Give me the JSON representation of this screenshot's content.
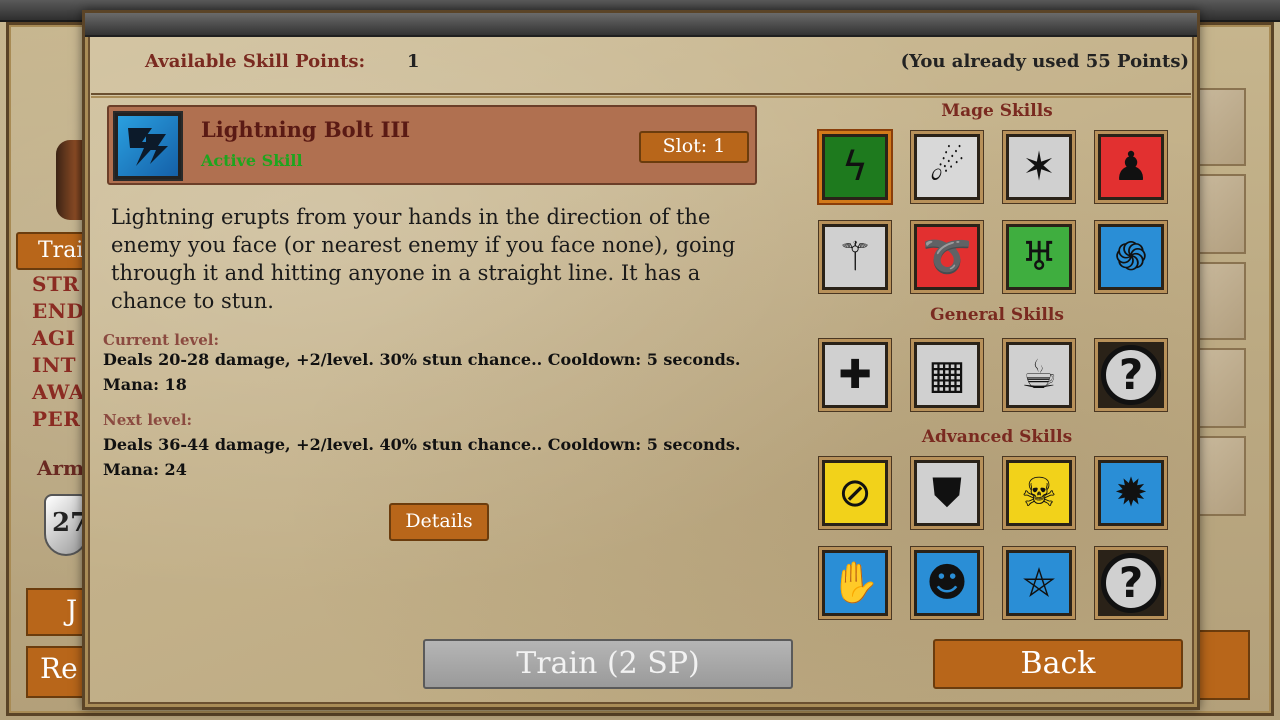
{
  "background": {
    "train_tab": "Trai",
    "stats": [
      "STR",
      "END",
      "AGI",
      "INT",
      "AWA",
      "PER"
    ],
    "armor_label": "Arm",
    "armor_value": "27",
    "btn_top": "J",
    "btn_bottom": "Re"
  },
  "header": {
    "available_label": "Available Skill Points:",
    "available_value": "1",
    "used_text": "(You already used 55 Points)"
  },
  "selected_skill": {
    "name": "Lightning Bolt III",
    "type": "Active Skill",
    "slot_label": "Slot: 1",
    "icon": "lightning-icon",
    "description": "Lightning erupts from your hands in the direction of the enemy you face (or nearest enemy if you face none), going through it and hitting anyone in a straight line. It has a chance to stun.",
    "current_label": "Current level:",
    "current_text": "Deals 20-28 damage, +2/level. 30% stun chance.. Cooldown: 5 seconds. Mana: 18",
    "next_label": "Next level:",
    "next_text": "Deals 36-44 damage, +2/level. 40% stun chance.. Cooldown: 5 seconds. Mana: 24",
    "details_label": "Details"
  },
  "sections": {
    "mage": "Mage Skills",
    "general": "General Skills",
    "advanced": "Advanced Skills"
  },
  "skills": {
    "mage": [
      {
        "icon": "lightning-icon",
        "glyph": "ϟ",
        "bg": "#1e7a1e"
      },
      {
        "icon": "fireball-icon",
        "glyph": "☄",
        "bg": "#d8d8d8"
      },
      {
        "icon": "meteor-icon",
        "glyph": "✶",
        "bg": "#d0d0d0"
      },
      {
        "icon": "protection-figure-icon",
        "glyph": "♟",
        "bg": "#e23030"
      },
      {
        "icon": "staff-icon",
        "glyph": "⚚",
        "bg": "#d0d0d0"
      },
      {
        "icon": "fire-swirl-icon",
        "glyph": "➰",
        "bg": "#e23030"
      },
      {
        "icon": "gargoyle-icon",
        "glyph": "♅",
        "bg": "#3fae3f"
      },
      {
        "icon": "vortex-icon",
        "glyph": "֍",
        "bg": "#2a8ed6"
      }
    ],
    "general": [
      {
        "icon": "heal-cross-icon",
        "glyph": "✚",
        "bg": "#d0d0d0"
      },
      {
        "icon": "maze-icon",
        "glyph": "▦",
        "bg": "#d0d0d0"
      },
      {
        "icon": "beer-mug-icon",
        "glyph": "☕",
        "bg": "#d0d0d0"
      },
      {
        "icon": "unknown-skill-icon",
        "glyph": "?",
        "bg": "#d0d0d0"
      }
    ],
    "advanced": [
      {
        "icon": "no-weapon-icon",
        "glyph": "⊘",
        "bg": "#f2d21a"
      },
      {
        "icon": "armor-plate-icon",
        "glyph": "⛊",
        "bg": "#d0d0d0"
      },
      {
        "icon": "skull-icon",
        "glyph": "☠",
        "bg": "#f2d21a"
      },
      {
        "icon": "shield-burst-icon",
        "glyph": "✹",
        "bg": "#2a8ed6"
      },
      {
        "icon": "hand-swirl-icon",
        "glyph": "✋",
        "bg": "#2a8ed6"
      },
      {
        "icon": "golem-face-icon",
        "glyph": "☻",
        "bg": "#2a8ed6"
      },
      {
        "icon": "pentagram-icon",
        "glyph": "⛤",
        "bg": "#2a8ed6"
      },
      {
        "icon": "unknown-skill-icon",
        "glyph": "?",
        "bg": "#d0d0d0"
      }
    ]
  },
  "footer": {
    "train_label": "Train (2 SP)",
    "back_label": "Back"
  }
}
